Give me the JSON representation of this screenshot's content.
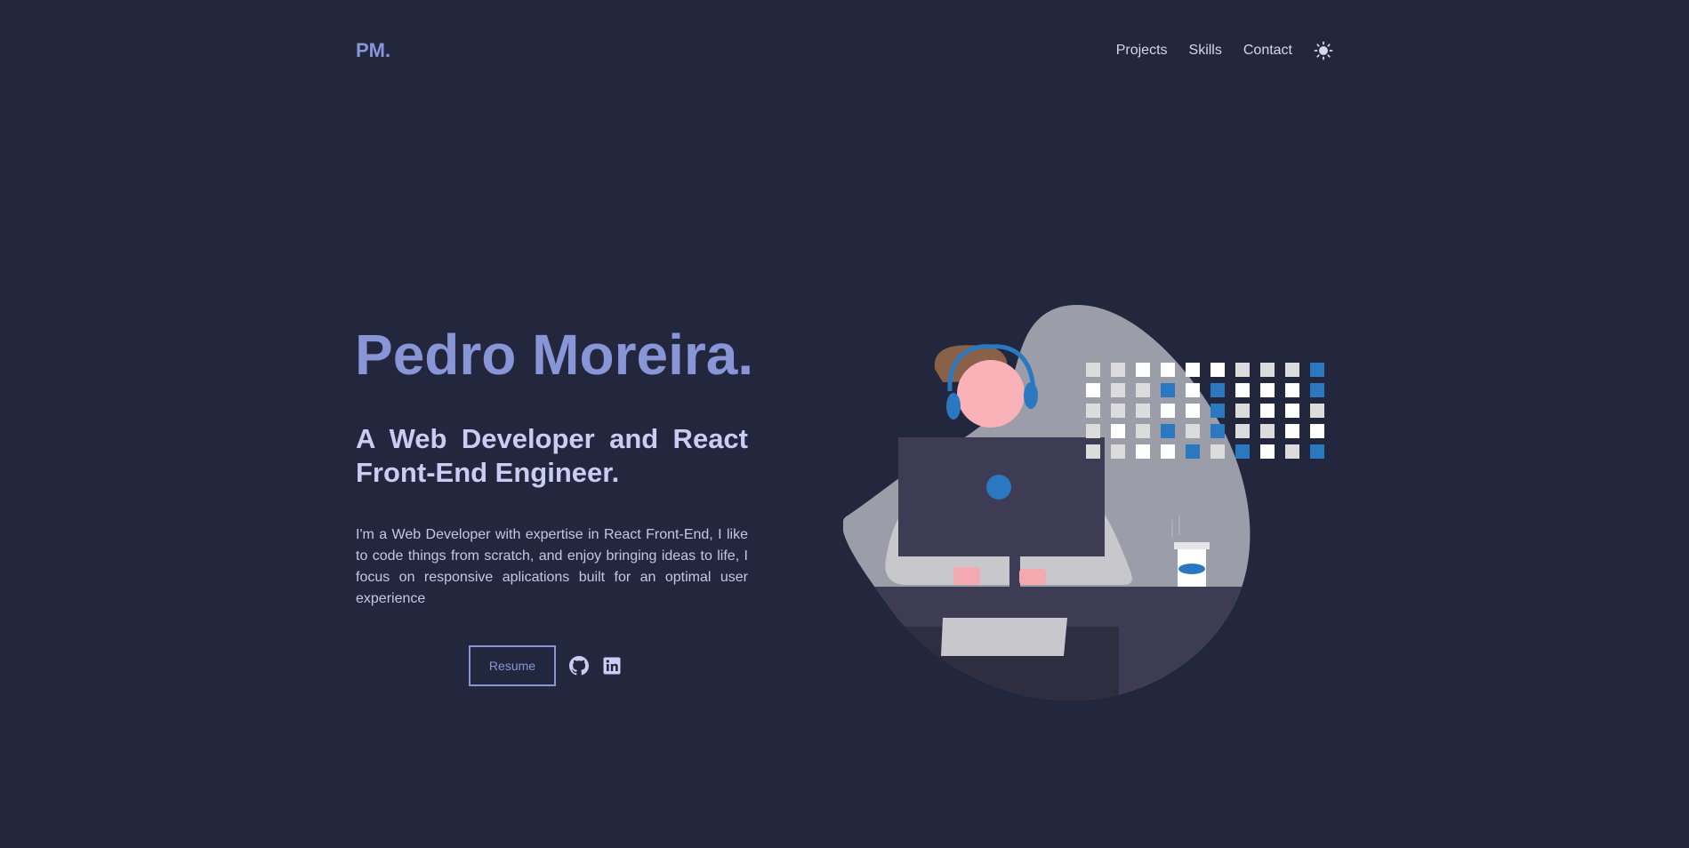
{
  "header": {
    "logo": "PM.",
    "nav": {
      "projects": "Projects",
      "skills": "Skills",
      "contact": "Contact"
    },
    "theme_icon": "sun-icon"
  },
  "hero": {
    "name": "Pedro Moreira.",
    "subtitle": "A Web Developer and React Front-End Engineer.",
    "description": "I'm a Web Developer with expertise in React Front-End, I like to code things from scratch, and enjoy bringing ideas to life, I focus on responsive aplications built for an optimal user experience",
    "resume_label": "Resume",
    "social_icons": [
      "github-icon",
      "linkedin-icon"
    ]
  },
  "colors": {
    "background": "#23273d",
    "accent": "#8896d8",
    "heading": "#c9ccf3",
    "text": "#c4c7e6",
    "illustration_blue": "#2a78bf",
    "illustration_gray": "#9b9ea9"
  }
}
